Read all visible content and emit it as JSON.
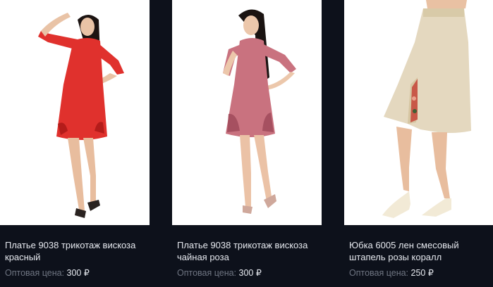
{
  "products": [
    {
      "title_line1": "Платье 9038 трикотаж вискоза",
      "title_line2": "красный",
      "price_label": "Оптовая цена:",
      "price_value": "300 ₽",
      "image_icon": "red-dress-photo",
      "color": "#e0312d"
    },
    {
      "title_line1": "Платье 9038 трикотаж вискоза",
      "title_line2": "чайная роза",
      "price_label": "Оптовая цена:",
      "price_value": "300 ₽",
      "image_icon": "pink-dress-photo",
      "color": "#c9727f"
    },
    {
      "title_line1": "Юбка 6005 лен смесовый",
      "title_line2": "штапель розы коралл",
      "price_label": "Оптовая цена:",
      "price_value": "250 ₽",
      "image_icon": "linen-skirt-photo",
      "color": "#e4d8bf"
    }
  ]
}
